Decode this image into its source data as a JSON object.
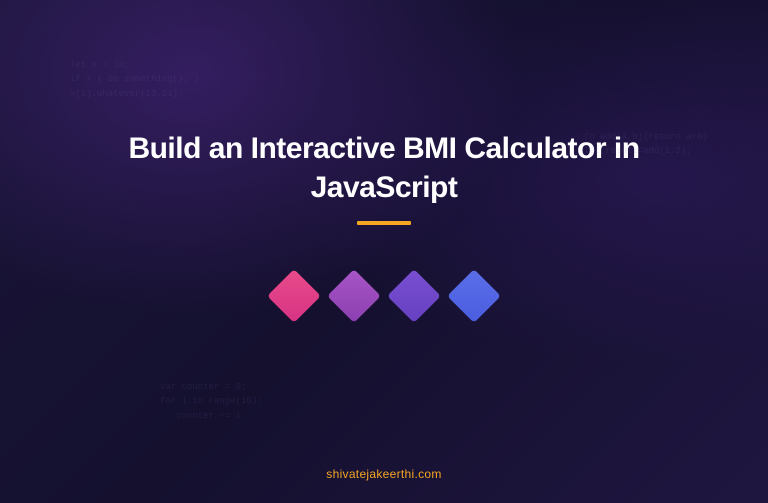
{
  "hero": {
    "title": "Build an Interactive BMI Calculator in JavaScript"
  },
  "footer": {
    "site": "shivatejakeerthi.com"
  },
  "decorations": {
    "squares": [
      {
        "name": "square-pink"
      },
      {
        "name": "square-purple"
      },
      {
        "name": "square-violet"
      },
      {
        "name": "square-blue"
      }
    ]
  }
}
